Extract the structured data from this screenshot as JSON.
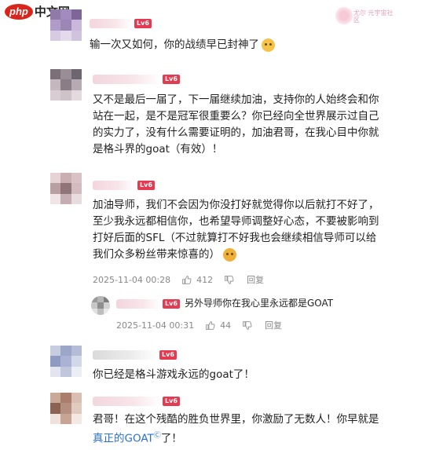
{
  "watermark": {
    "brand": "php",
    "site": "中文网",
    "deco_text": "尤尔 元宇宙社区"
  },
  "level_badge": "Lv6",
  "comments": [
    {
      "id": "c1",
      "badge": "Lv6",
      "text": [
        "输一次又如何，你的战绩早已封神了"
      ],
      "emoji": "cat-face-icon"
    },
    {
      "id": "c2",
      "badge": "Lv6",
      "text": [
        "又不是最后一届了，下一届继续加油，支持你的人始终会和你",
        "站在一起，是不是冠军很重要么？你已经向全世界展示过自己",
        "的实力了，没有什么需要证明的，加油君哥，在我心目中你就",
        "是格斗界的goat（有效）！"
      ]
    },
    {
      "id": "c3",
      "badge": "Lv6",
      "text": [
        "加油导师，我们不会因为你没打好就觉得你以后就打不好了，",
        "至少我永远都相信你，也希望导师调整好心态，不要被影响到",
        "打好后面的SFL（不过就算打不好我也会继续相信导师可以给",
        "我们众多粉丝带来惊喜的）"
      ],
      "meta": {
        "time": "2025-11-04 00:28",
        "likes": "412",
        "reply": "回复"
      }
    },
    {
      "id": "c3r",
      "badge": "Lv6",
      "text": [
        "另外导师你在我心里永远都是GOAT"
      ],
      "meta": {
        "time": "2025-11-04 00:31",
        "likes": "44",
        "reply": "回复"
      }
    },
    {
      "id": "c4",
      "badge": "Lv6",
      "text": [
        "你已经是格斗游戏永远的goat了！"
      ]
    },
    {
      "id": "c5",
      "badge": "Lv6",
      "text": [
        "君哥！在这个残酷的胜负世界里，你激励了无数人！你早就是"
      ],
      "link": "真正的GOAT",
      "tail": "了！"
    }
  ],
  "colors": {
    "badge": "#e33c52",
    "link": "#2b73c9"
  }
}
